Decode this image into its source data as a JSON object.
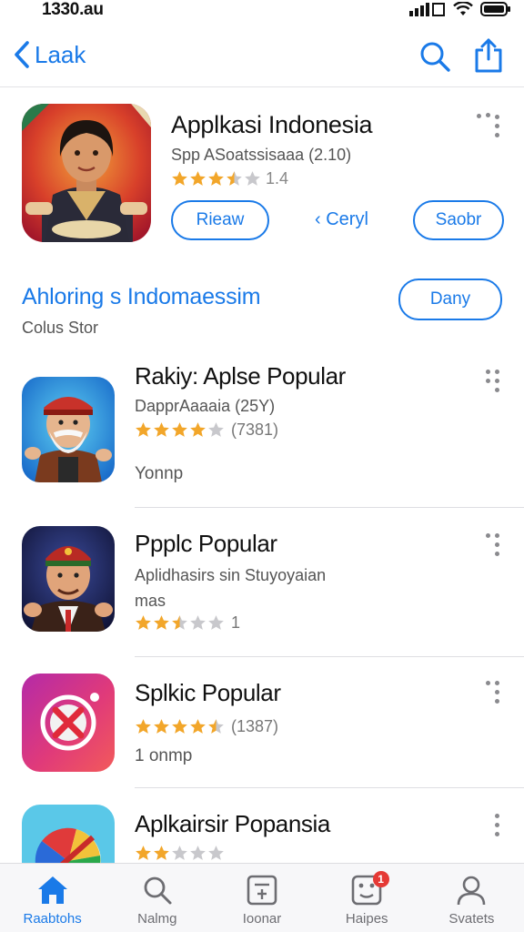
{
  "status": {
    "time": "1330.au"
  },
  "nav": {
    "back_label": "Laak"
  },
  "featured": {
    "title": "Applkasi Indonesia",
    "subtitle": "Spp ASoatssisaaa (2.10)",
    "rating_text": "1.4",
    "rating": 3.5,
    "button1": "Rieaw",
    "link": "‹ Ceryl",
    "button2": "Saobr"
  },
  "section": {
    "title": "Ahloring s Indomaessim",
    "subtitle": "Colus Stor",
    "button": "Dany"
  },
  "apps": [
    {
      "title": "Rakiy: Aplse Popular",
      "subtitle": "DapprAaaaia (25Y)",
      "rating": 4,
      "rating_text": "(7381)",
      "extra": "Yonnp"
    },
    {
      "title": "Ppplc Popular",
      "subtitle": "Aplidhasirs sin Stuyoyaian",
      "subtitle2": "mas",
      "rating": 2.5,
      "rating_text": "1",
      "extra": ""
    },
    {
      "title": "Splkic Popular",
      "subtitle": "",
      "rating": 4.5,
      "rating_text": "(1387)",
      "extra": "1 onmp"
    },
    {
      "title": "Aplkairsir Popansia",
      "subtitle": "",
      "rating": 2,
      "rating_text": "",
      "extra": ""
    }
  ],
  "tabs": [
    {
      "label": "Raabtohs",
      "icon": "home-icon",
      "active": true
    },
    {
      "label": "Nalmg",
      "icon": "search-icon"
    },
    {
      "label": "Ioonar",
      "icon": "calculator-icon"
    },
    {
      "label": "Haipes",
      "icon": "dice-icon",
      "badge": "1"
    },
    {
      "label": "Svatets",
      "icon": "person-icon"
    }
  ],
  "colors": {
    "accent": "#1a7ae8",
    "star": "#f2a62a",
    "star_empty": "#c8c8cc",
    "badge": "#e53935"
  }
}
